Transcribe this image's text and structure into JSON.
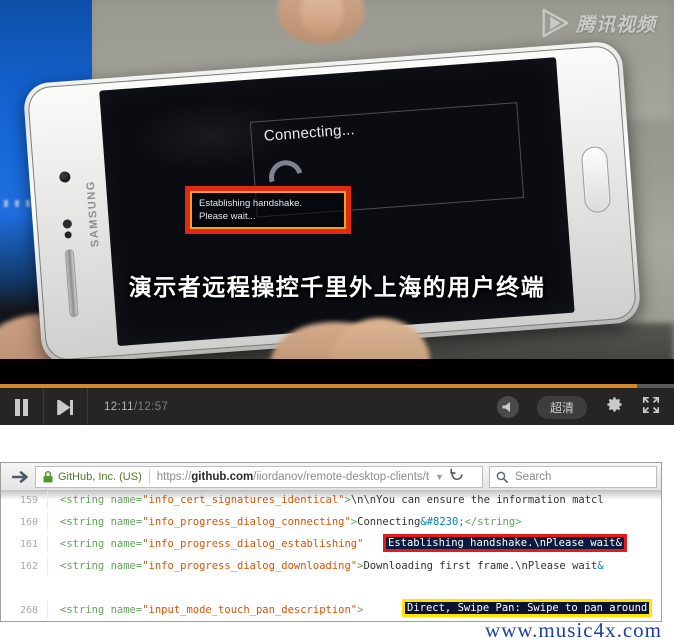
{
  "player": {
    "logo_text": "腾讯视频",
    "logo_icon": "play-triangle-icon",
    "phone_brand": "SAMSUNG",
    "dialog_title": "Connecting...",
    "dialog_highlight_line1": "Establishing handshake.",
    "dialog_highlight_line2": "Please wait...",
    "subtitle": "演示者远程操控千里外上海的用户终端",
    "controls": {
      "pause_icon": "pause-icon",
      "next_icon": "next-track-icon",
      "current_time": "12:11",
      "time_separator": "/",
      "total_time": "12:57",
      "volume_icon": "volume-icon",
      "quality_label": "超清",
      "settings_icon": "gear-icon",
      "fullscreen_icon": "fullscreen-icon",
      "progress_percent": 94.5,
      "accent_color": "#d4882c"
    }
  },
  "browser": {
    "forward_icon": "forward-arrow-icon",
    "lock_icon": "lock-icon",
    "site_identity": "GitHub, Inc. (US)",
    "url_scheme": "https://",
    "url_host": "github.com",
    "url_path": "/iiordanov/remote-desktop-clients/t",
    "dropdown_icon": "chevron-down-icon",
    "reload_icon": "reload-icon",
    "search_icon": "search-icon",
    "search_placeholder": "Search",
    "identity_color": "#4a7a28"
  },
  "code": {
    "lines": [
      {
        "number": "159",
        "open": "<string name=",
        "attr": "\"info_cert_signatures_identical\"",
        "close": ">",
        "text": "\\n\\nYou can ensure the information matcl"
      },
      {
        "number": "160",
        "open": "<string name=",
        "attr": "\"info_progress_dialog_connecting\"",
        "close": ">",
        "text": "Connecting",
        "entity": "&#8230;",
        "tail": "</string>"
      },
      {
        "number": "161",
        "open": "<string name=",
        "attr": "\"info_progress_dialog_establishing\"",
        "close": ">",
        "text": ""
      },
      {
        "number": "162",
        "open": "<string name=",
        "attr": "\"info_progress_dialog_downloading\"",
        "close": ">",
        "text": "Downloading first frame.\\nPlease wait",
        "entity": "&"
      },
      {
        "number": "268",
        "open": "<string name=",
        "attr": "\"input_mode_touch_pan_description\"",
        "close": ">",
        "text": ""
      }
    ],
    "highlight_red": "Establishing handshake.\\nPlease wait&",
    "highlight_yellow": "Direct, Swipe Pan: Swipe to pan around",
    "highlight_red_border": "#e81919",
    "highlight_yellow_border": "#ffe400"
  },
  "watermark": "www.music4x.com"
}
